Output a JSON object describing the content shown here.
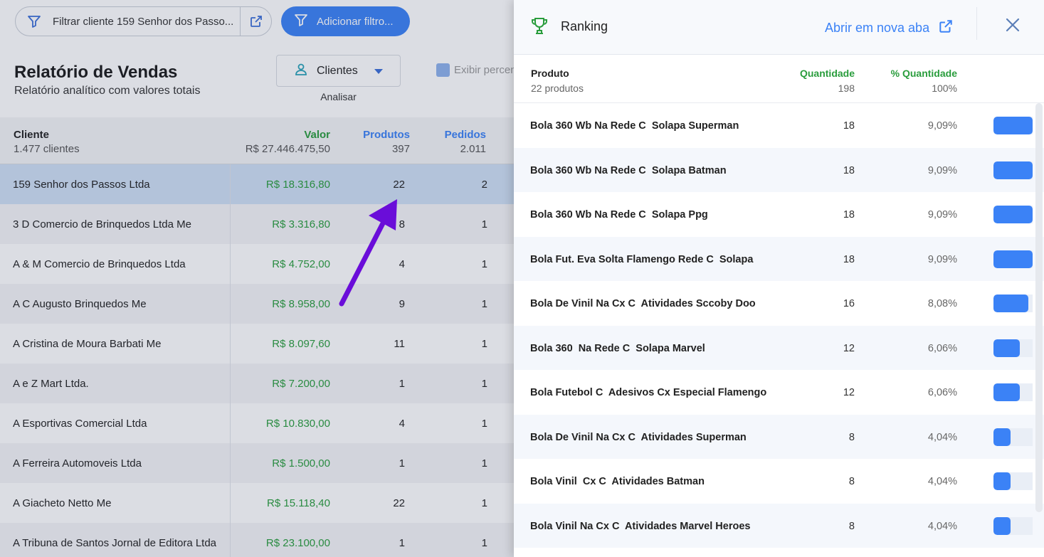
{
  "filter_bar": {
    "client_filter_text": "Filtrar cliente 159 Senhor dos Passo...",
    "add_filter_label": "Adicionar filtro..."
  },
  "report": {
    "title": "Relatório de Vendas",
    "subtitle": "Relatório analítico com valores totais",
    "dimension_selected": "Clientes",
    "dimension_caption": "Analisar",
    "percent_checkbox_label": "Exibir percen"
  },
  "table": {
    "headers": {
      "client": "Cliente",
      "client_total": "1.477 clientes",
      "valor": "Valor",
      "valor_total": "R$ 27.446.475,50",
      "produtos": "Produtos",
      "produtos_total": "397",
      "pedidos": "Pedidos",
      "pedidos_total": "2.011"
    },
    "rows": [
      {
        "client": "159 Senhor dos Passos Ltda",
        "valor": "R$ 18.316,80",
        "produtos": "22",
        "pedidos": "2"
      },
      {
        "client": "3 D Comercio de Brinquedos Ltda Me",
        "valor": "R$ 3.316,80",
        "produtos": "8",
        "pedidos": "1"
      },
      {
        "client": "A & M Comercio de Brinquedos Ltda",
        "valor": "R$ 4.752,00",
        "produtos": "4",
        "pedidos": "1"
      },
      {
        "client": "A C Augusto Brinquedos Me",
        "valor": "R$ 8.958,00",
        "produtos": "9",
        "pedidos": "1"
      },
      {
        "client": "A Cristina de Moura Barbati Me",
        "valor": "R$ 8.097,60",
        "produtos": "11",
        "pedidos": "1"
      },
      {
        "client": "A e Z  Mart Ltda.",
        "valor": "R$ 7.200,00",
        "produtos": "1",
        "pedidos": "1"
      },
      {
        "client": "A Esportivas Comercial Ltda",
        "valor": "R$ 10.830,00",
        "produtos": "4",
        "pedidos": "1"
      },
      {
        "client": "A Ferreira Automoveis Ltda",
        "valor": "R$ 1.500,00",
        "produtos": "1",
        "pedidos": "1"
      },
      {
        "client": "A Giacheto Netto Me",
        "valor": "R$ 15.118,40",
        "produtos": "22",
        "pedidos": "1"
      },
      {
        "client": "A Tribuna de Santos Jornal de Editora Ltda",
        "valor": "R$ 23.100,00",
        "produtos": "1",
        "pedidos": "1"
      }
    ]
  },
  "ranking": {
    "title": "Ranking",
    "open_new_tab": "Abrir em nova aba",
    "headers": {
      "produto": "Produto",
      "produto_total": "22 produtos",
      "quantidade": "Quantidade",
      "quantidade_total": "198",
      "pct": "% Quantidade",
      "pct_total": "100%"
    },
    "rows": [
      {
        "name": "Bola 360 Wb Na Rede C  Solapa Superman",
        "qty": "18",
        "pct": "9,09%",
        "share": 1.0
      },
      {
        "name": "Bola 360 Wb Na Rede C  Solapa Batman",
        "qty": "18",
        "pct": "9,09%",
        "share": 1.0
      },
      {
        "name": "Bola 360 Wb Na Rede C  Solapa Ppg",
        "qty": "18",
        "pct": "9,09%",
        "share": 1.0
      },
      {
        "name": "Bola Fut. Eva Solta Flamengo Rede C  Solapa",
        "qty": "18",
        "pct": "9,09%",
        "share": 1.0
      },
      {
        "name": "Bola De Vinil Na Cx C  Atividades Sccoby Doo",
        "qty": "16",
        "pct": "8,08%",
        "share": 0.889
      },
      {
        "name": "Bola 360  Na Rede C  Solapa Marvel",
        "qty": "12",
        "pct": "6,06%",
        "share": 0.667
      },
      {
        "name": "Bola Futebol C  Adesivos Cx Especial Flamengo",
        "qty": "12",
        "pct": "6,06%",
        "share": 0.667
      },
      {
        "name": "Bola De Vinil Na Cx C  Atividades Superman",
        "qty": "8",
        "pct": "4,04%",
        "share": 0.444
      },
      {
        "name": "Bola Vinil  Cx C  Atividades Batman",
        "qty": "8",
        "pct": "4,04%",
        "share": 0.444
      },
      {
        "name": "Bola Vinil Na Cx C  Atividades Marvel Heroes",
        "qty": "8",
        "pct": "4,04%",
        "share": 0.444
      }
    ]
  },
  "colors": {
    "accent": "#3b82f6",
    "positive": "#2a9d3d",
    "annotation_arrow": "#6a0dd9"
  }
}
